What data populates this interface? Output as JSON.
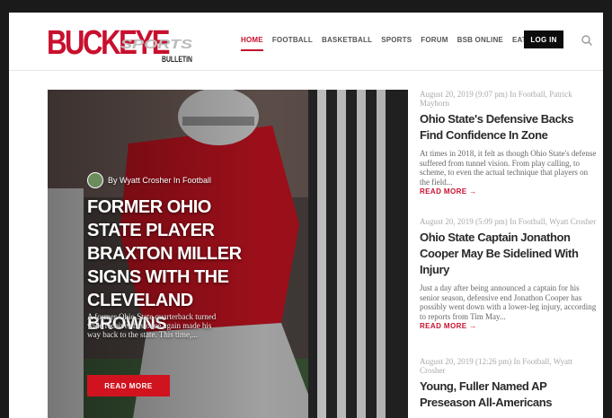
{
  "header": {
    "logo_main": "BUCKEYE",
    "logo_sub1": "SPORTS",
    "logo_sub2": "BULLETIN",
    "nav": [
      "HOME",
      "FOOTBALL",
      "BASKETBALL",
      "SPORTS",
      "FORUM",
      "BSB ONLINE",
      "EAT & STAY"
    ],
    "login_label": "LOG IN",
    "search_icon": "search-icon"
  },
  "hero": {
    "byline": "By Wyatt Crosher In Football",
    "title": "FORMER OHIO STATE PLAYER BRAXTON MILLER SIGNS WITH THE CLEVELAND BROWNS",
    "excerpt": "A former Ohio State quarterback turned wide receiver has once again made his way back to the state. This time,...",
    "read_more": "READ MORE"
  },
  "articles": [
    {
      "meta": "August 20, 2019 (9:07 pm) In Football, Patrick Mayhorn",
      "title": "Ohio State's Defensive Backs Find Confidence In Zone",
      "excerpt": "At times in 2018, it felt as though Ohio State's defense suffered from tunnel vision. From play calling, to scheme, to even the actual technique that players on the field...",
      "more": "READ MORE →"
    },
    {
      "meta": "August 20, 2019 (5:09 pm) In Football, Wyatt Crosher",
      "title": "Ohio State Captain Jonathon Cooper May Be Sidelined With Injury",
      "excerpt": "Just a day after being announced a captain for his senior season, defensive end Jonathon Cooper has possibly went down with a lower-leg injury, according to reports from Tim May...",
      "more": "READ MORE →"
    },
    {
      "meta": "August 20, 2019 (12:26 pm) In Football, Wyatt Crosher",
      "title": "Young, Fuller Named AP Preseason All-Americans"
    }
  ],
  "colors": {
    "brand_red": "#c8102e",
    "button_red": "#d0131e",
    "dark": "#0c0c0c"
  }
}
